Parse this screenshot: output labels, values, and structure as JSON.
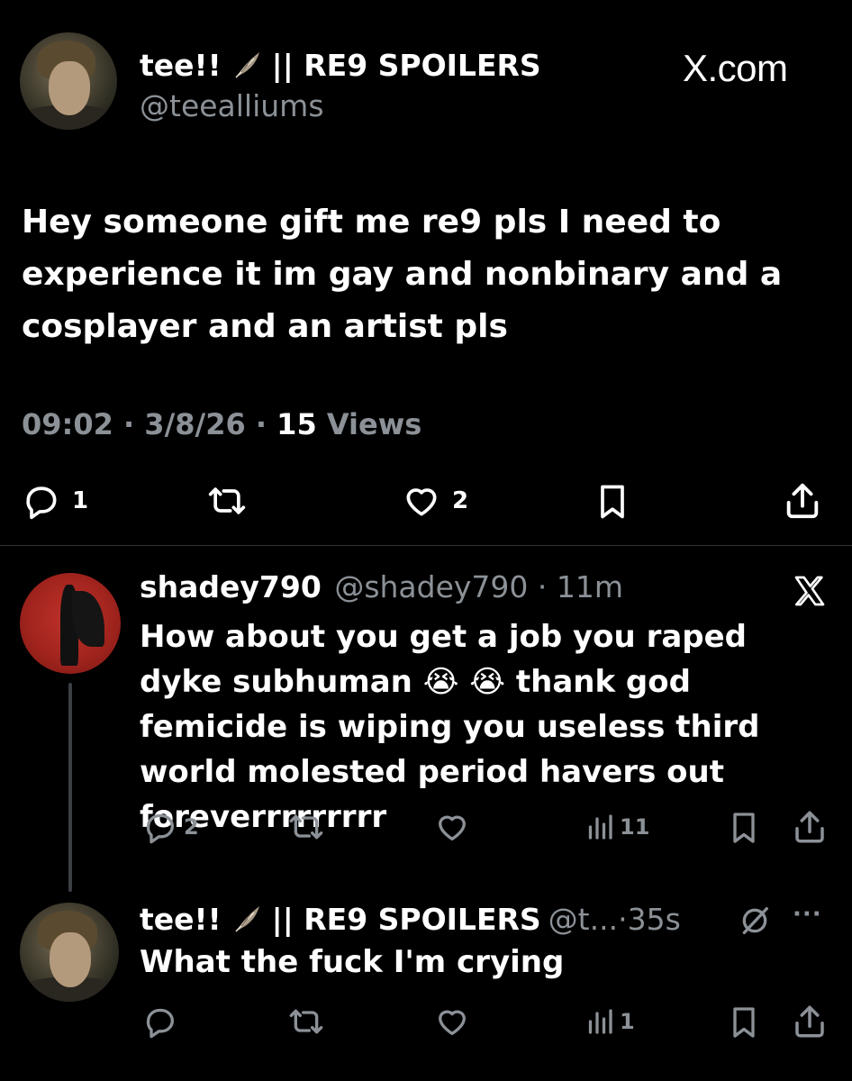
{
  "tweet": {
    "display_name": "tee!!",
    "name_suffix": "|| RE9 SPOILERS",
    "handle": "@teealliums",
    "brand": "X.com",
    "text": "Hey someone gift me re9 pls I need to experience it im gay and nonbinary and a cosplayer and an artist pls",
    "time": "09:02",
    "date": "3/8/26",
    "views_count": "15",
    "views_label": "Views",
    "dot": "·",
    "reply_count": "1",
    "like_count": "2"
  },
  "reply1": {
    "display_name": "shadey790",
    "handle": "@shadey790",
    "dot": "·",
    "age": "11m",
    "text_part1": "How about you get a job you raped dyke subhuman",
    "text_part2": "thank god femicide is wiping you useless third world molested period havers out foreverrrrrrrrr",
    "emoji1": "😭",
    "emoji2": "😭",
    "reply_count": "2",
    "views_count": "11"
  },
  "reply2": {
    "display_name": "tee!!",
    "name_suffix": "|| RE9 SPOILERS",
    "handle": "@t...",
    "dot": "·",
    "age": "35s",
    "text": "What the fuck I'm crying",
    "views_count": "1",
    "more": "···"
  },
  "icons": [
    "feather-icon",
    "x-logo-icon",
    "reply-icon",
    "retweet-icon",
    "heart-icon",
    "bookmark-icon",
    "share-icon",
    "views-icon",
    "grok-icon",
    "more-icon"
  ],
  "colors": {
    "background": "#000000",
    "text": "#ffffff",
    "muted": "#8b9197",
    "divider": "#2f3336"
  }
}
